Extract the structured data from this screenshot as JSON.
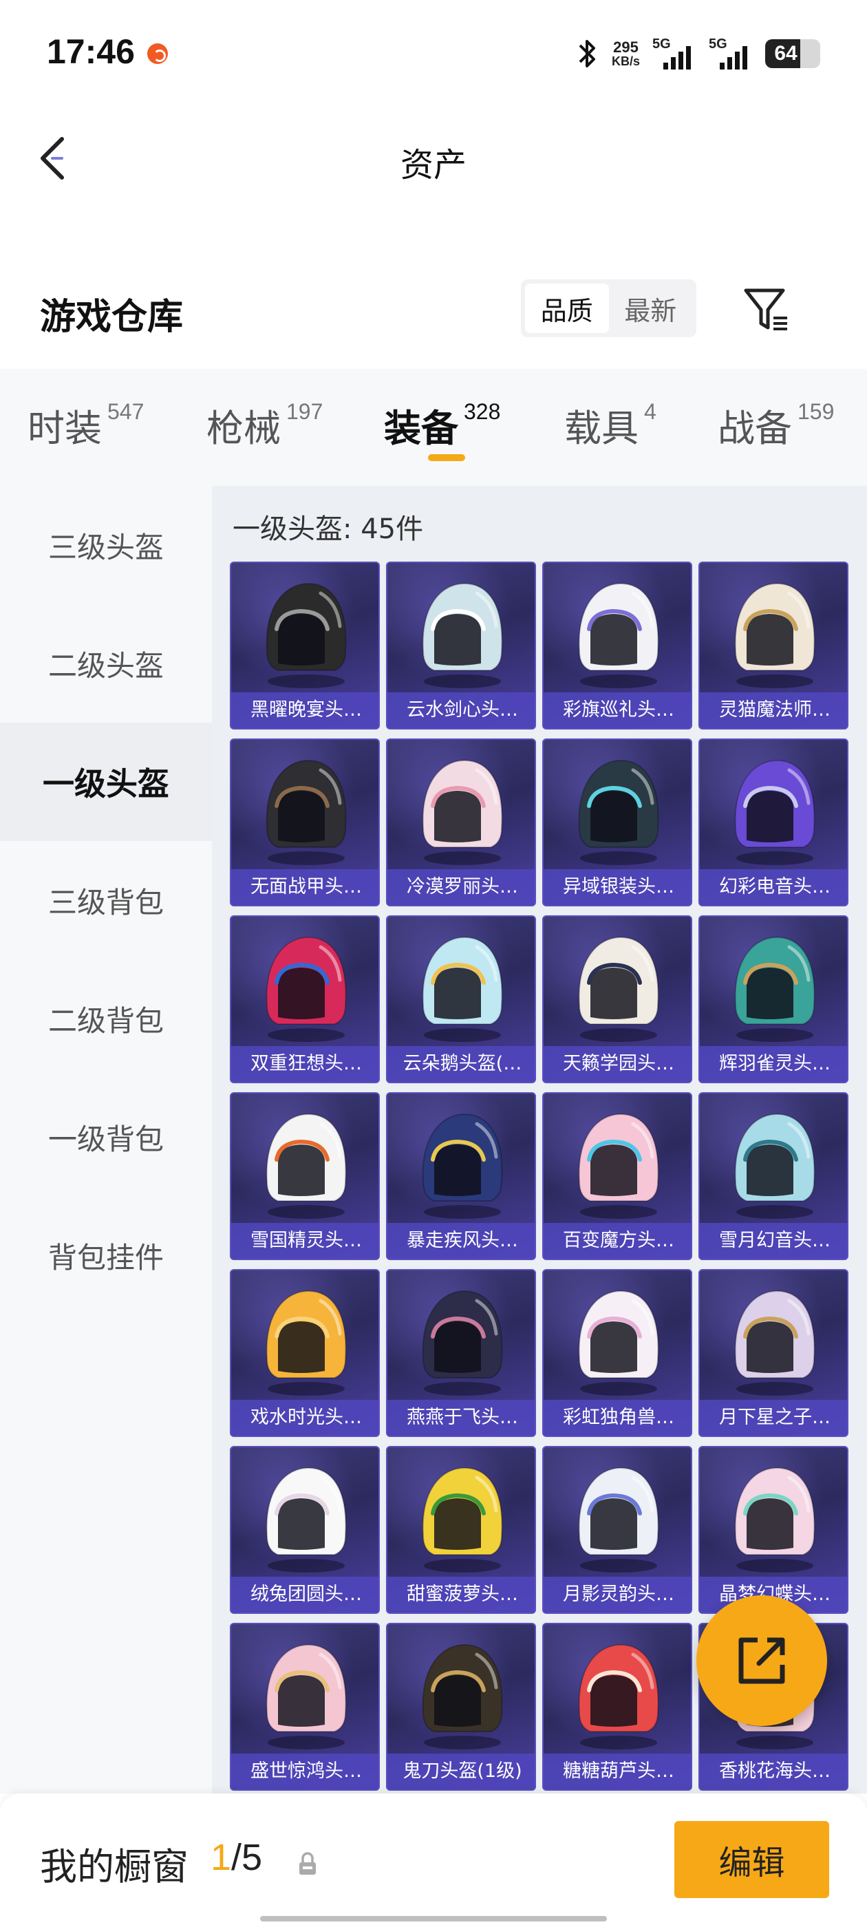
{
  "status_bar": {
    "time": "17:46",
    "speed_value": "295",
    "speed_unit": "KB/s",
    "signal1_label": "5G",
    "signal2_label": "5G",
    "battery": "64",
    "battery_level": 0.64
  },
  "nav": {
    "title": "资产",
    "back_icon": "chevron-left-icon"
  },
  "header": {
    "title": "游戏仓库",
    "sort_options": [
      "品质",
      "最新"
    ],
    "sort_selected": "品质",
    "filter_icon": "filter-icon"
  },
  "categories": [
    {
      "name": "时装",
      "count": "547"
    },
    {
      "name": "枪械",
      "count": "197"
    },
    {
      "name": "装备",
      "count": "328"
    },
    {
      "name": "载具",
      "count": "4"
    },
    {
      "name": "战备",
      "count": "159"
    }
  ],
  "active_category": "装备",
  "sidebar": {
    "items": [
      "三级头盔",
      "二级头盔",
      "一级头盔",
      "三级背包",
      "二级背包",
      "一级背包",
      "背包挂件"
    ],
    "active": "一级头盔"
  },
  "content": {
    "subtitle": "一级头盔: 45件",
    "items": [
      {
        "label": "黑曜晚宴头…",
        "color": "#2b2b2b",
        "accent": "#9a9a9a"
      },
      {
        "label": "云水剑心头…",
        "color": "#cfe3ea",
        "accent": "#ffffff"
      },
      {
        "label": "彩旗巡礼头…",
        "color": "#f2f2f6",
        "accent": "#7b6fd6"
      },
      {
        "label": "灵猫魔法师…",
        "color": "#efe6d6",
        "accent": "#c9a25c"
      },
      {
        "label": "无面战甲头…",
        "color": "#2e2e33",
        "accent": "#8b6a4a"
      },
      {
        "label": "冷漠罗丽头…",
        "color": "#f3dbe4",
        "accent": "#e89bb0"
      },
      {
        "label": "异域银装头…",
        "color": "#2a3a44",
        "accent": "#5ed2e0"
      },
      {
        "label": "幻彩电音头…",
        "color": "#6a4bd6",
        "accent": "#c9c9f0"
      },
      {
        "label": "双重狂想头…",
        "color": "#d82a5a",
        "accent": "#2f6ad6"
      },
      {
        "label": "云朵鹅头盔(…",
        "color": "#bfe8f2",
        "accent": "#f2c14e"
      },
      {
        "label": "天籁学园头…",
        "color": "#f0ece4",
        "accent": "#2a3152"
      },
      {
        "label": "辉羽雀灵头…",
        "color": "#3aa39a",
        "accent": "#c9a25c"
      },
      {
        "label": "雪国精灵头…",
        "color": "#f4f4f4",
        "accent": "#e86a2a"
      },
      {
        "label": "暴走疾风头…",
        "color": "#2a3a7a",
        "accent": "#e8c84e"
      },
      {
        "label": "百变魔方头…",
        "color": "#f6c6d6",
        "accent": "#4ec6e8"
      },
      {
        "label": "雪月幻音头…",
        "color": "#a8dbe8",
        "accent": "#2f7a8a"
      },
      {
        "label": "戏水时光头…",
        "color": "#f6b43a",
        "accent": "#f8d37a"
      },
      {
        "label": "燕燕于飞头…",
        "color": "#2d2d4a",
        "accent": "#c97a9a"
      },
      {
        "label": "彩虹独角兽…",
        "color": "#f6f0f6",
        "accent": "#e8b0d6"
      },
      {
        "label": "月下星之子…",
        "color": "#ddd0ea",
        "accent": "#c9a25c"
      },
      {
        "label": "绒兔团圆头…",
        "color": "#f8f8f8",
        "accent": "#e6d6e6"
      },
      {
        "label": "甜蜜菠萝头…",
        "color": "#f2d23a",
        "accent": "#3a9a3a"
      },
      {
        "label": "月影灵韵头…",
        "color": "#eef0f8",
        "accent": "#6a7ad6"
      },
      {
        "label": "晶梦幻蝶头…",
        "color": "#f4d6e4",
        "accent": "#7ad6c4"
      },
      {
        "label": "盛世惊鸿头…",
        "color": "#f4c6d2",
        "accent": "#e8c07a"
      },
      {
        "label": "鬼刀头盔(1级)",
        "color": "#3a3226",
        "accent": "#c9a25c"
      },
      {
        "label": "糖糖葫芦头…",
        "color": "#e84a4a",
        "accent": "#f8e6d6"
      },
      {
        "label": "香桃花海头…",
        "color": "#f6d0dc",
        "accent": "#e88aa6"
      }
    ]
  },
  "fab": {
    "icon": "share-external-icon"
  },
  "bottom": {
    "showcase_label": "我的橱窗",
    "showcase_current": "1",
    "showcase_total": "/5",
    "lock_icon": "lock-icon",
    "edit_label": "编辑"
  }
}
